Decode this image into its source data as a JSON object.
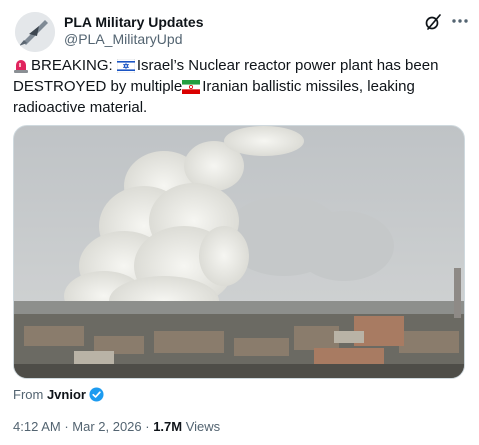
{
  "author": {
    "name": "PLA Military Updates",
    "handle": "@PLA_MilitaryUpd"
  },
  "tweet": {
    "part1": "BREAKING: ",
    "part2": "Israel’s Nuclear reactor power plant has been DESTROYED by multiple",
    "part3": "Iranian ballistic missiles, leaking radioactive material."
  },
  "attribution": {
    "prefix": "From ",
    "source": "Jvnior"
  },
  "meta": {
    "time": "4:12 AM",
    "sep1": " · ",
    "date": "Mar 2, 2026",
    "sep2": " · ",
    "views_count": "1.7M",
    "views_label": " Views"
  },
  "icons": {
    "grok": "grok-icon",
    "more": "more-icon",
    "siren": "police-light-emoji",
    "israel_flag": "israel-flag-emoji",
    "iran_flag": "iran-flag-emoji",
    "verified": "verified-badge-icon"
  },
  "colors": {
    "text": "#0f1419",
    "secondary": "#536471",
    "verified": "#1d9bf0"
  }
}
